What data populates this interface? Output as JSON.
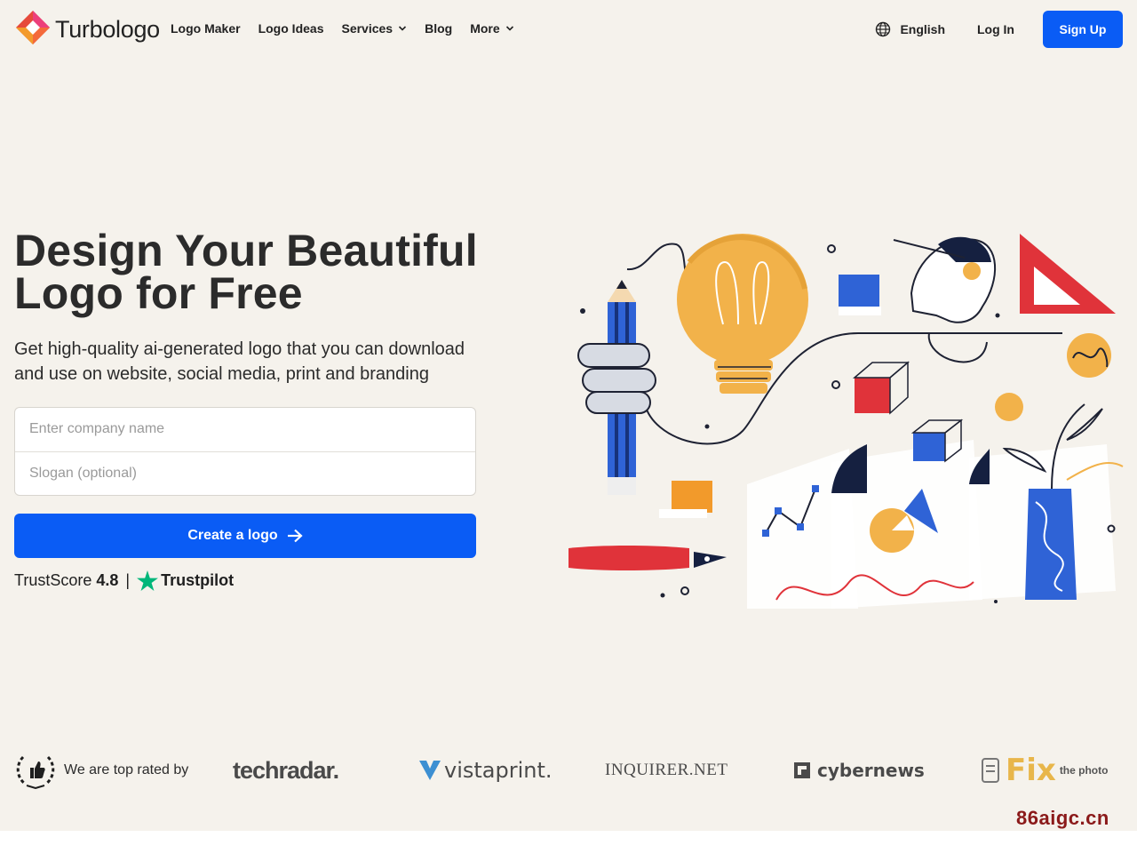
{
  "header": {
    "brand": "Turbologo",
    "nav": [
      {
        "label": "Logo Maker"
      },
      {
        "label": "Logo Ideas"
      },
      {
        "label": "Services",
        "dropdown": true
      },
      {
        "label": "Blog"
      },
      {
        "label": "More",
        "dropdown": true
      }
    ],
    "language": "English",
    "login": "Log In",
    "signup": "Sign Up"
  },
  "hero": {
    "title_line1": "Design Your Beautiful",
    "title_line2": "Logo for Free",
    "subtitle_line1": "Get high-quality ai-generated logo that you can download",
    "subtitle_line2": "and use on website, social media, print and branding",
    "company_placeholder": "Enter company name",
    "slogan_placeholder": "Slogan (optional)",
    "cta": "Create a logo",
    "trust_label": "TrustScore",
    "trust_score": "4.8",
    "trust_sep": "|",
    "trust_brand": "Trustpilot"
  },
  "rated": {
    "text": "We are top rated by",
    "logos": [
      "techradar.",
      "vistaprint.",
      "INQUIRER.NET",
      "cybernews",
      "Fix",
      "the photo"
    ]
  },
  "watermark": "86aigc.cn",
  "colors": {
    "primary": "#0a5cf5",
    "background": "#f5f2ec",
    "trustpilot_green": "#00b67a",
    "text": "#2b2b2b"
  },
  "icons": [
    "turbologo-logo-icon",
    "chevron-down-icon",
    "globe-icon",
    "arrow-right-icon",
    "star-icon",
    "laurel-thumbs-up-icon"
  ]
}
